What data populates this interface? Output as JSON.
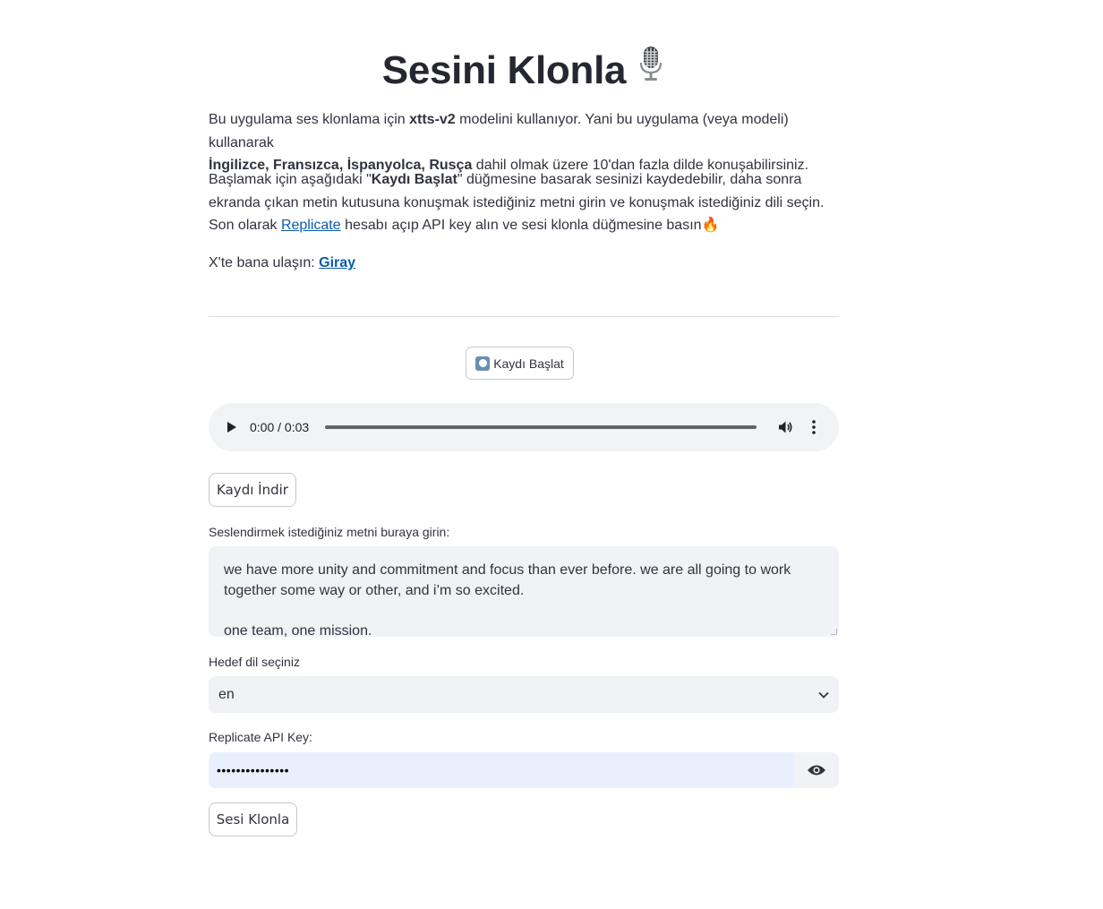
{
  "header": {
    "title": "Sesini Klonla",
    "title_icon": "microphone-icon"
  },
  "intro": {
    "p1_a": "Bu uygulama ses klonlama için ",
    "p1_model": "xtts-v2",
    "p1_b": " modelini kullanıyor. Yani bu uygulama (veya modeli) kullanarak ",
    "p1_langs": "İngilizce, Fransızca, İspanyolca, Rusça",
    "p1_c": " dahil olmak üzere 10'dan fazla dilde konuşabilirsiniz.",
    "p2_a": "Başlamak için aşağıdaki \"",
    "p2_btn": "Kaydı Başlat",
    "p2_b": "\" düğmesine basarak sesinizi kaydedebilir, daha sonra ekranda çıkan metin kutusuna konuşmak istediğiniz metni girin ve konuşmak istediğiniz dili seçin. Son olarak ",
    "p2_link": "Replicate",
    "p2_c": " hesabı açıp API key alın ve sesi klonla düğmesine basın",
    "p2_emoji": "🔥",
    "p3_a": "X'te bana ulaşın: ",
    "p3_link": "Giray"
  },
  "recorder": {
    "start_label": "Kaydı Başlat",
    "icon": "record-icon"
  },
  "audio": {
    "time": "0:00 / 0:03",
    "progress": 0
  },
  "download": {
    "label": "Kaydı İndir"
  },
  "text_input": {
    "label": "Seslendirmek istediğiniz metni buraya girin:",
    "value": "we have more unity and commitment and focus than ever before. we are all going to work together some way or other, and i’m so excited.\n\none team, one mission."
  },
  "language": {
    "label": "Hedef dil seçiniz",
    "selected": "en"
  },
  "api_key": {
    "label": "Replicate API Key:",
    "masked_value": "•••••••••••••••"
  },
  "clone": {
    "label": "Sesi Klonla"
  },
  "colors": {
    "link": "#0b5cad",
    "field_bg": "#f0f2f6",
    "autofill_bg": "#e8f0fe",
    "text": "#31333f"
  }
}
